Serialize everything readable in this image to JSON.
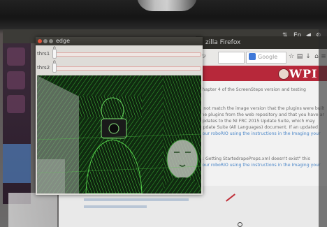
{
  "firefox": {
    "title": "zilla Firefox",
    "search_placeholder": "Google",
    "banner_logo": "WPI"
  },
  "web_doc_lines": [
    {
      "text": "chapter 4 of the ScreenSteps version and testing",
      "link": false
    },
    {
      "text": "",
      "link": false
    },
    {
      "text": "",
      "link": false
    },
    {
      "text": "s not match the image version that the plugins were built",
      "link": false
    },
    {
      "text": "the plugins from the web repository and that you have an",
      "link": false
    },
    {
      "text": "updates to the NI FRC 2015 Update Suite, which may",
      "link": false
    },
    {
      "text": "Update Suite (All Languages) document. If an updated",
      "link": false
    },
    {
      "text": "your roboRIO using the instructions in the Imaging your",
      "link": true
    },
    {
      "text": "",
      "link": false
    },
    {
      "text": "",
      "link": false
    },
    {
      "text": "",
      "link": false
    },
    {
      "text": "7: Getting StartedrapeProps.xml doesn't exist\" this",
      "link": false
    },
    {
      "text": "your roboRIO using the instructions in the Imaging your",
      "link": true
    },
    {
      "text": "",
      "link": false
    }
  ],
  "edge_window": {
    "title": "edge",
    "trackbars": [
      {
        "label": "thrs1",
        "value": "0",
        "fraction": 0.0
      },
      {
        "label": "thrs2",
        "value": "0",
        "fraction": 0.0
      }
    ]
  },
  "colors": {
    "titlebar": "#3c3b37",
    "close_dot": "#e0553b",
    "min_dot": "#8a8a85",
    "max_dot": "#8a8a85",
    "wpi_banner": "#b7283a",
    "edge_green": "#41c43a"
  }
}
